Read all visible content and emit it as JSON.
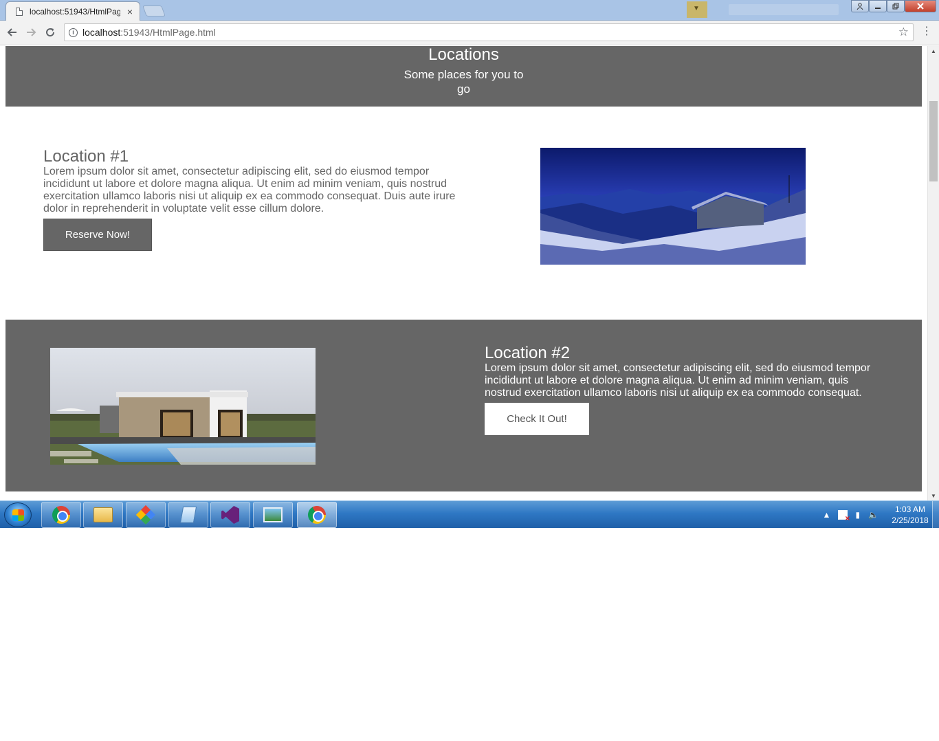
{
  "browser": {
    "tab_title": "localhost:51943/HtmlPag",
    "tab_close": "×",
    "url_host": "localhost",
    "url_rest": ":51943/HtmlPage.html"
  },
  "page": {
    "header": {
      "title": "Locations",
      "subtitle": "Some places for you to go"
    },
    "location1": {
      "title": "Location #1",
      "body": "Lorem ipsum dolor sit amet, consectetur adipiscing elit, sed do eiusmod tempor incididunt ut labore et dolore magna aliqua. Ut enim ad minim veniam, quis nostrud exercitation ullamco laboris nisi ut aliquip ex ea commodo consequat. Duis aute irure dolor in reprehenderit in voluptate velit esse cillum dolore.",
      "button": "Reserve Now!"
    },
    "location2": {
      "title": "Location #2",
      "body": "Lorem ipsum dolor sit amet, consectetur adipiscing elit, sed do eiusmod tempor incididunt ut labore et dolore magna aliqua. Ut enim ad minim veniam, quis nostrud exercitation ullamco laboris nisi ut aliquip ex ea commodo consequat.",
      "button": "Check It Out!"
    }
  },
  "taskbar": {
    "clock_time": "1:03 AM",
    "clock_date": "2/25/2018"
  }
}
